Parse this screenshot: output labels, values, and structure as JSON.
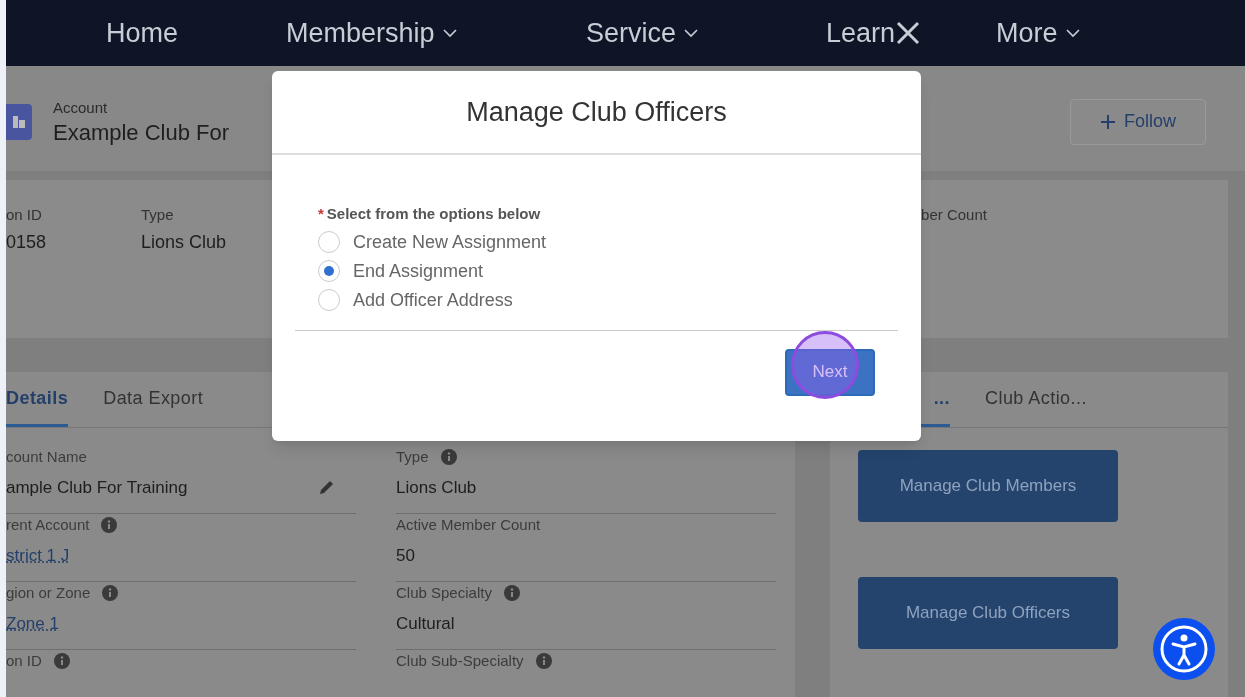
{
  "nav": [
    {
      "label": "Home",
      "kind": "plain"
    },
    {
      "label": "Membership",
      "kind": "dropdown"
    },
    {
      "label": "Service",
      "kind": "dropdown"
    },
    {
      "label": "Learn",
      "kind": "close"
    },
    {
      "label": "More",
      "kind": "dropdown"
    }
  ],
  "header": {
    "object_type": "Account",
    "title": "Example Club For",
    "follow_button": "Follow"
  },
  "highlights": [
    {
      "label": "on ID",
      "value": "0158"
    },
    {
      "label": "Type",
      "value": "Lions Club"
    },
    {
      "label": "ber Count"
    }
  ],
  "details_tabs": [
    {
      "label": "Details",
      "selected": true
    },
    {
      "label": "Data Export",
      "selected": false
    }
  ],
  "fields_left": [
    {
      "label": "count Name",
      "value": "ample Club For Training",
      "info": false,
      "link": false,
      "editable": true
    },
    {
      "label": "rent Account",
      "value": "strict 1 J",
      "info": true,
      "link": true,
      "editable": false
    },
    {
      "label": "gion or Zone",
      "value": "Zone 1",
      "info": true,
      "link": true,
      "editable": false
    },
    {
      "label": "on ID",
      "info": true
    }
  ],
  "fields_right": [
    {
      "label": "Type",
      "value": "Lions Club",
      "info": true
    },
    {
      "label": "Active Member Count",
      "value": "50",
      "info": false
    },
    {
      "label": "Club Specialty",
      "value": "Cultural",
      "info": true
    },
    {
      "label": "Club Sub-Specialty",
      "info": true
    }
  ],
  "side_tabs": [
    {
      "label": "...",
      "selected": true
    },
    {
      "label": "Club Actio...",
      "selected": false
    }
  ],
  "actions": [
    "Manage Club Members",
    "Manage Club Officers"
  ],
  "modal": {
    "title": "Manage Club Officers",
    "question": "Select from the options below",
    "required_mark": "*",
    "options": [
      {
        "label": "Create New Assignment",
        "selected": false
      },
      {
        "label": "End Assignment",
        "selected": true
      },
      {
        "label": "Add Officer Address",
        "selected": false
      }
    ],
    "next_button": "Next"
  }
}
